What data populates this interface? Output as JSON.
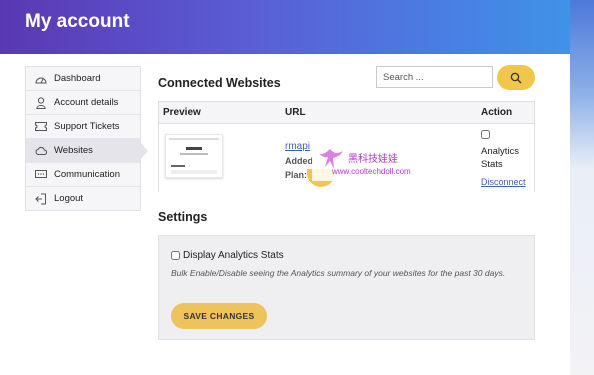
{
  "header": {
    "title": "My account"
  },
  "sidebar": {
    "items": [
      {
        "label": "Dashboard",
        "icon": "dashboard-icon"
      },
      {
        "label": "Account details",
        "icon": "user-icon"
      },
      {
        "label": "Support Tickets",
        "icon": "ticket-icon"
      },
      {
        "label": "Websites",
        "icon": "cloud-icon",
        "active": true
      },
      {
        "label": "Communication",
        "icon": "chat-icon"
      },
      {
        "label": "Logout",
        "icon": "logout-icon"
      }
    ]
  },
  "websites": {
    "title": "Connected Websites",
    "search_placeholder": "Search ...",
    "columns": {
      "preview": "Preview",
      "url": "URL",
      "action": "Action"
    },
    "rows": [
      {
        "url": "rmapi",
        "added_label": "Added",
        "plan_label": "Plan:",
        "action_checkbox_label": "Analytics Stats",
        "disconnect_label": "Disconnect"
      }
    ]
  },
  "settings": {
    "title": "Settings",
    "checkbox_label": "Display Analytics Stats",
    "help_text": "Bulk Enable/Disable seeing the Analytics summary of your websites for the past 30 days.",
    "save_label": "SAVE CHANGES"
  },
  "watermark": {
    "text": "黑科技娃娃",
    "url": "www.cooltechdoll.com"
  },
  "colors": {
    "accent_yellow": "#f1c64d",
    "header_start": "#5a38b3",
    "header_end": "#3f93e8",
    "link_blue": "#3f5fbf"
  }
}
